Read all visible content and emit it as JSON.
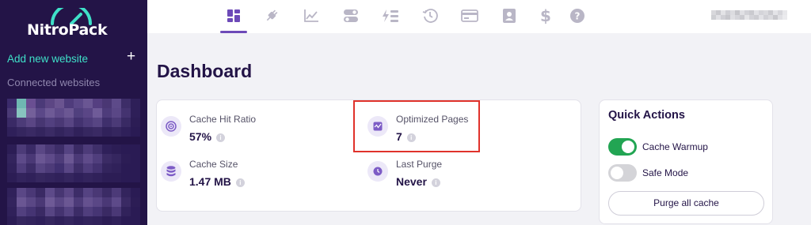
{
  "app": {
    "brand": "NitroPack"
  },
  "sidebar": {
    "add_website_label": "Add new website",
    "add_icon": "plus-icon",
    "connected_label": "Connected websites"
  },
  "topnav": {
    "icons": [
      "dashboard-icon",
      "plug-icon",
      "chart-line-icon",
      "toggles-icon",
      "bolt-list-icon",
      "history-icon",
      "credit-card-icon",
      "user-card-icon",
      "dollar-icon",
      "help-icon"
    ],
    "active": "dashboard-icon"
  },
  "main": {
    "title": "Dashboard",
    "stats": {
      "cache_hit_ratio": {
        "label": "Cache Hit Ratio",
        "value": "57%"
      },
      "optimized_pages": {
        "label": "Optimized Pages",
        "value": "7"
      },
      "cache_size": {
        "label": "Cache Size",
        "value": "1.47 MB"
      },
      "last_purge": {
        "label": "Last Purge",
        "value": "Never"
      }
    },
    "info_glyph": "i"
  },
  "quick_actions": {
    "title": "Quick Actions",
    "cache_warmup": {
      "label": "Cache Warmup",
      "on": true
    },
    "safe_mode": {
      "label": "Safe Mode",
      "on": false
    },
    "purge_label": "Purge all cache"
  },
  "colors": {
    "sidebar_bg": "#231447",
    "accent_teal": "#3fe0c8",
    "accent_purple": "#6d4ab8",
    "toggle_on": "#22a553",
    "highlight_red": "#e0322b"
  }
}
